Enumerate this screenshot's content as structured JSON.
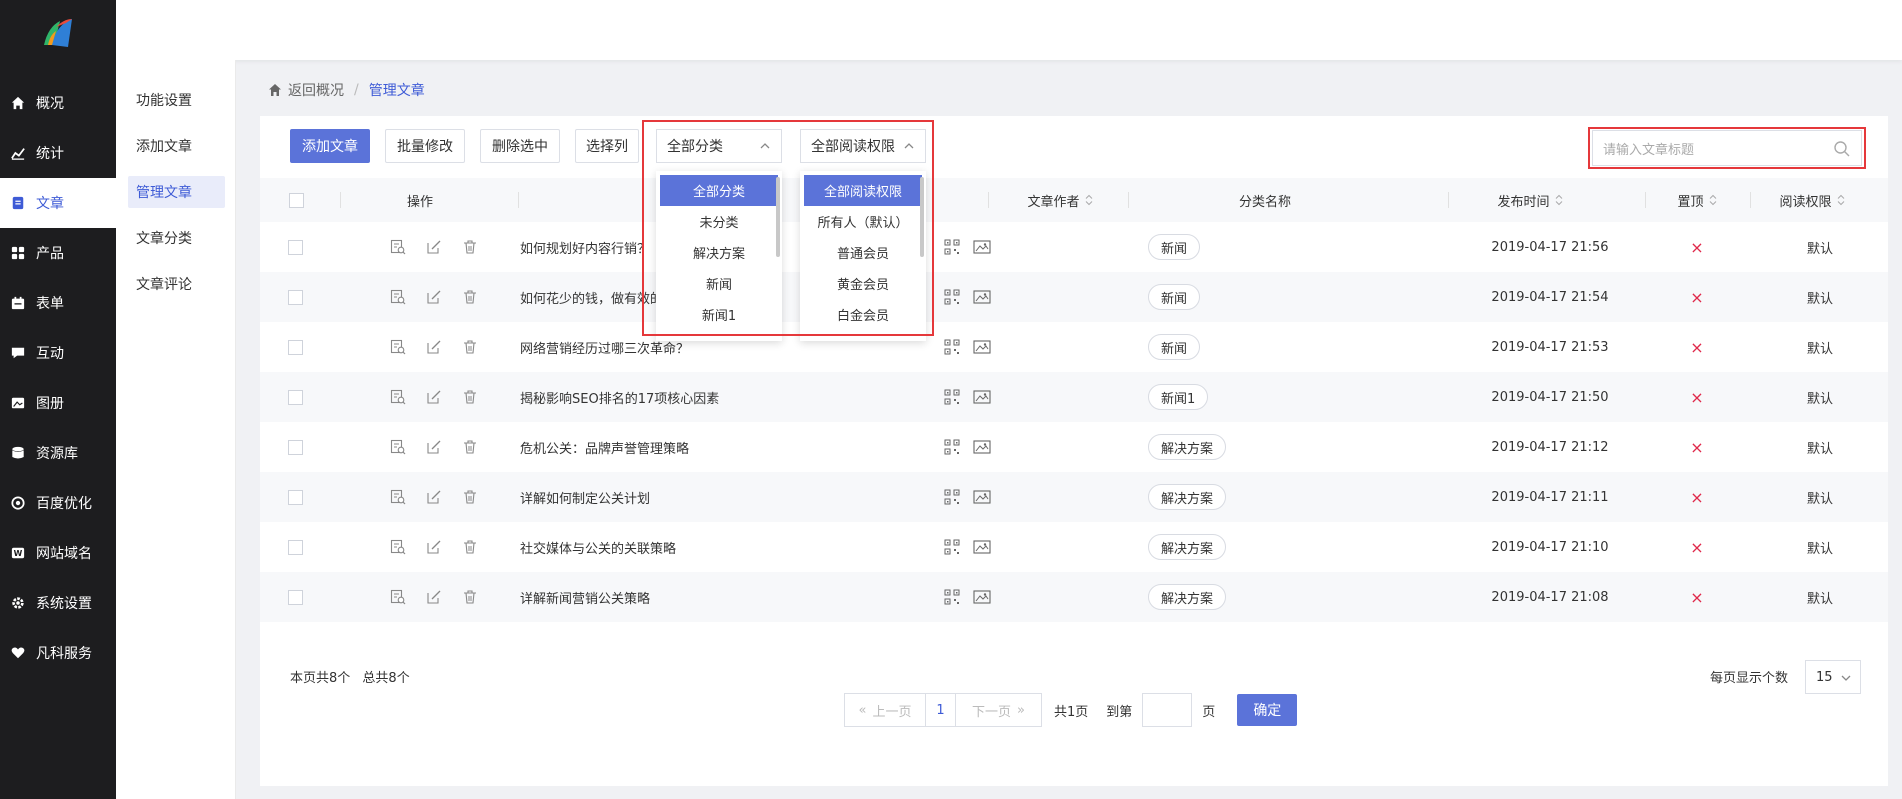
{
  "nav": {
    "items": [
      {
        "label": "概况",
        "icon": "home-icon"
      },
      {
        "label": "统计",
        "icon": "chart-icon"
      },
      {
        "label": "文章",
        "icon": "article-icon"
      },
      {
        "label": "产品",
        "icon": "grid-icon"
      },
      {
        "label": "表单",
        "icon": "calendar-icon"
      },
      {
        "label": "互动",
        "icon": "chat-icon"
      },
      {
        "label": "图册",
        "icon": "image-icon"
      },
      {
        "label": "资源库",
        "icon": "database-icon"
      },
      {
        "label": "百度优化",
        "icon": "seo-icon"
      },
      {
        "label": "网站域名",
        "icon": "domain-icon"
      },
      {
        "label": "系统设置",
        "icon": "gear-icon"
      },
      {
        "label": "凡科服务",
        "icon": "heart-icon"
      }
    ]
  },
  "submenu": {
    "items": [
      "功能设置",
      "添加文章",
      "管理文章",
      "文章分类",
      "文章评论"
    ]
  },
  "breadcrumb": {
    "back": "返回概况",
    "current": "管理文章"
  },
  "toolbar": {
    "add": "添加文章",
    "batch": "批量修改",
    "delete": "删除选中",
    "columns": "选择列",
    "category_select": "全部分类",
    "permission_select": "全部阅读权限"
  },
  "category_options": [
    "全部分类",
    "未分类",
    "解决方案",
    "新闻",
    "新闻1"
  ],
  "permission_options": [
    "全部阅读权限",
    "所有人（默认）",
    "普通会员",
    "黄金会员",
    "白金会员"
  ],
  "search": {
    "placeholder": "请输入文章标题"
  },
  "table": {
    "headers": {
      "ops": "操作",
      "author": "文章作者",
      "category": "分类名称",
      "time": "发布时间",
      "top": "置顶",
      "permission": "阅读权限"
    },
    "rows": [
      {
        "title": "如何规划好内容行销？",
        "category": "新闻",
        "time": "2019-04-17 21:56",
        "top": "×",
        "permission": "默认"
      },
      {
        "title": "如何花少的钱，做有效的",
        "category": "新闻",
        "time": "2019-04-17 21:54",
        "top": "×",
        "permission": "默认"
      },
      {
        "title": "网络营销经历过哪三次革命？",
        "category": "新闻",
        "time": "2019-04-17 21:53",
        "top": "×",
        "permission": "默认"
      },
      {
        "title": "揭秘影响SEO排名的17项核心因素",
        "category": "新闻1",
        "time": "2019-04-17 21:50",
        "top": "×",
        "permission": "默认"
      },
      {
        "title": "危机公关：品牌声誉管理策略",
        "category": "解决方案",
        "time": "2019-04-17 21:12",
        "top": "×",
        "permission": "默认"
      },
      {
        "title": "详解如何制定公关计划",
        "category": "解决方案",
        "time": "2019-04-17 21:11",
        "top": "×",
        "permission": "默认"
      },
      {
        "title": "社交媒体与公关的关联策略",
        "category": "解决方案",
        "time": "2019-04-17 21:10",
        "top": "×",
        "permission": "默认"
      },
      {
        "title": "详解新闻营销公关策略",
        "category": "解决方案",
        "time": "2019-04-17 21:08",
        "top": "×",
        "permission": "默认"
      }
    ]
  },
  "footer": {
    "page_count": "本页共8个",
    "total": "总共8个",
    "prev": "上一页",
    "page": "1",
    "next": "下一页",
    "total_pages": "共1页",
    "goto": "到第",
    "page_unit": "页",
    "confirm": "确定",
    "per_page_label": "每页显示个数",
    "per_page": "15"
  },
  "colors": {
    "accent": "#5b73d9",
    "highlight": "#e5383b",
    "nav_bg": "#1d1d1f"
  }
}
